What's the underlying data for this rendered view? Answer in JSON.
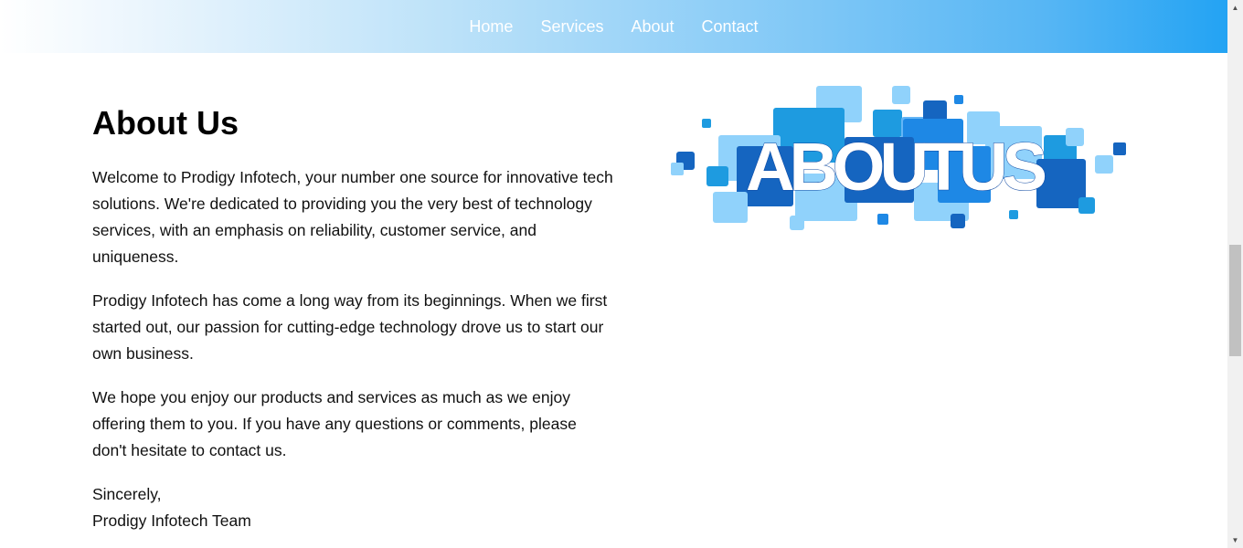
{
  "nav": {
    "items": [
      {
        "label": "Home"
      },
      {
        "label": "Services"
      },
      {
        "label": "About"
      },
      {
        "label": "Contact"
      }
    ]
  },
  "main": {
    "title": "About Us",
    "paragraphs": [
      "Welcome to Prodigy Infotech, your number one source for innovative tech solutions. We're dedicated to providing you the very best of technology services, with an emphasis on reliability, customer service, and uniqueness.",
      "Prodigy Infotech has come a long way from its beginnings. When we first started out, our passion for cutting-edge technology drove us to start our own business.",
      "We hope you enjoy our products and services as much as we enjoy offering them to you. If you have any questions or comments, please don't hesitate to contact us."
    ],
    "signoff": "Sincerely,",
    "signature": "Prodigy Infotech Team",
    "image_text": "ABOUTUS"
  },
  "colors": {
    "nav_gradient_end": "#23a3f3",
    "tile_dark": "#1565c0",
    "tile_mid": "#2196f3",
    "tile_light": "#90d2fb"
  }
}
